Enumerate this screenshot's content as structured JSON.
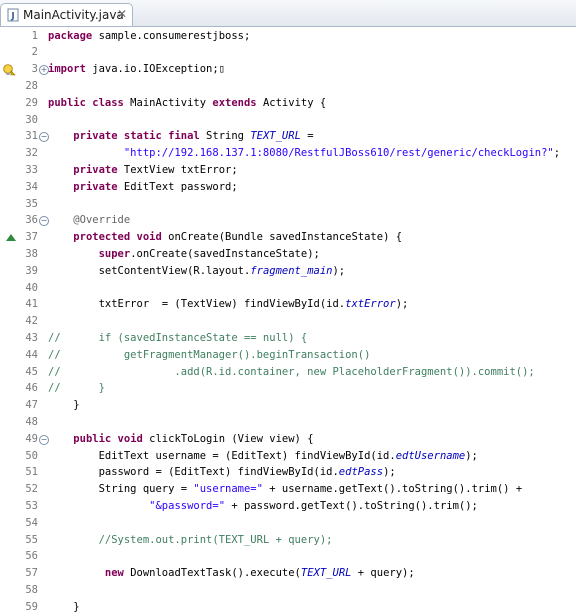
{
  "tab": {
    "title": "MainActivity.java",
    "close_glyph": "✕",
    "icon": "java-file-icon"
  },
  "lines": [
    {
      "no": "1",
      "segs": [
        {
          "t": "package",
          "c": "kw"
        },
        {
          "t": " sample.consumerestjboss;",
          "c": ""
        }
      ]
    },
    {
      "no": "2",
      "segs": []
    },
    {
      "no": "3",
      "fold": "plus",
      "marker": "warning",
      "segs": [
        {
          "t": "import",
          "c": "kw"
        },
        {
          "t": " java.io.IOException;",
          "c": ""
        },
        {
          "t": "▯",
          "c": ""
        }
      ]
    },
    {
      "no": "28",
      "segs": []
    },
    {
      "no": "29",
      "segs": [
        {
          "t": "public class",
          "c": "kw"
        },
        {
          "t": " MainActivity ",
          "c": ""
        },
        {
          "t": "extends",
          "c": "kw"
        },
        {
          "t": " Activity {",
          "c": ""
        }
      ]
    },
    {
      "no": "30",
      "segs": []
    },
    {
      "no": "31",
      "fold": "minus",
      "segs": [
        {
          "t": "    ",
          "c": ""
        },
        {
          "t": "private static final",
          "c": "kw"
        },
        {
          "t": " String ",
          "c": ""
        },
        {
          "t": "TEXT_URL",
          "c": "fld"
        },
        {
          "t": " =",
          "c": ""
        }
      ]
    },
    {
      "no": "32",
      "segs": [
        {
          "t": "            ",
          "c": ""
        },
        {
          "t": "\"http://192.168.137.1:8080/RestfulJBoss610/rest/generic/checkLogin?\"",
          "c": "str"
        },
        {
          "t": ";",
          "c": ""
        }
      ]
    },
    {
      "no": "33",
      "segs": [
        {
          "t": "    ",
          "c": ""
        },
        {
          "t": "private",
          "c": "kw"
        },
        {
          "t": " TextView txtError;",
          "c": ""
        }
      ]
    },
    {
      "no": "34",
      "segs": [
        {
          "t": "    ",
          "c": ""
        },
        {
          "t": "private",
          "c": "kw"
        },
        {
          "t": " EditText password;",
          "c": ""
        }
      ]
    },
    {
      "no": "35",
      "segs": []
    },
    {
      "no": "36",
      "fold": "minus",
      "segs": [
        {
          "t": "    ",
          "c": ""
        },
        {
          "t": "@Override",
          "c": "ann"
        }
      ]
    },
    {
      "no": "37",
      "marker": "override",
      "segs": [
        {
          "t": "    ",
          "c": ""
        },
        {
          "t": "protected void",
          "c": "kw"
        },
        {
          "t": " onCreate(Bundle savedInstanceState) {",
          "c": ""
        }
      ]
    },
    {
      "no": "38",
      "segs": [
        {
          "t": "        ",
          "c": ""
        },
        {
          "t": "super",
          "c": "kw"
        },
        {
          "t": ".onCreate(savedInstanceState);",
          "c": ""
        }
      ]
    },
    {
      "no": "39",
      "segs": [
        {
          "t": "        setContentView(R.layout.",
          "c": ""
        },
        {
          "t": "fragment_main",
          "c": "fld"
        },
        {
          "t": ");",
          "c": ""
        }
      ]
    },
    {
      "no": "40",
      "segs": []
    },
    {
      "no": "41",
      "segs": [
        {
          "t": "        txtError  = (TextView) findViewById(id.",
          "c": ""
        },
        {
          "t": "txtError",
          "c": "fld"
        },
        {
          "t": ");",
          "c": ""
        }
      ]
    },
    {
      "no": "42",
      "segs": []
    },
    {
      "no": "43",
      "segs": [
        {
          "t": "//      if (savedInstanceState == null) {",
          "c": "cmt"
        }
      ]
    },
    {
      "no": "44",
      "segs": [
        {
          "t": "//          getFragmentManager().beginTransaction()",
          "c": "cmt"
        }
      ]
    },
    {
      "no": "45",
      "segs": [
        {
          "t": "//                  .add(R.id.container, new PlaceholderFragment()).commit();",
          "c": "cmt"
        }
      ]
    },
    {
      "no": "46",
      "segs": [
        {
          "t": "//      }",
          "c": "cmt"
        }
      ]
    },
    {
      "no": "47",
      "segs": [
        {
          "t": "    }",
          "c": ""
        }
      ]
    },
    {
      "no": "48",
      "segs": []
    },
    {
      "no": "49",
      "fold": "minus",
      "segs": [
        {
          "t": "    ",
          "c": ""
        },
        {
          "t": "public void",
          "c": "kw"
        },
        {
          "t": " clickToLogin (View view) {",
          "c": ""
        }
      ]
    },
    {
      "no": "50",
      "segs": [
        {
          "t": "        EditText username = (EditText) findViewById(id.",
          "c": ""
        },
        {
          "t": "edtUsername",
          "c": "fld"
        },
        {
          "t": ");",
          "c": ""
        }
      ]
    },
    {
      "no": "51",
      "segs": [
        {
          "t": "        password = (EditText) findViewById(id.",
          "c": ""
        },
        {
          "t": "edtPass",
          "c": "fld"
        },
        {
          "t": ");",
          "c": ""
        }
      ]
    },
    {
      "no": "52",
      "segs": [
        {
          "t": "        String query = ",
          "c": ""
        },
        {
          "t": "\"username=\"",
          "c": "str"
        },
        {
          "t": " + username.getText().toString().trim() +",
          "c": ""
        }
      ]
    },
    {
      "no": "53",
      "segs": [
        {
          "t": "                ",
          "c": ""
        },
        {
          "t": "\"&password=\"",
          "c": "str"
        },
        {
          "t": " + password.getText().toString().trim();",
          "c": ""
        }
      ]
    },
    {
      "no": "54",
      "segs": []
    },
    {
      "no": "55",
      "segs": [
        {
          "t": "        ",
          "c": ""
        },
        {
          "t": "//System.out.print(TEXT_URL + query);",
          "c": "cmt"
        }
      ]
    },
    {
      "no": "56",
      "segs": []
    },
    {
      "no": "57",
      "segs": [
        {
          "t": "         ",
          "c": ""
        },
        {
          "t": "new",
          "c": "kw"
        },
        {
          "t": " DownloadTextTask().execute(",
          "c": ""
        },
        {
          "t": "TEXT_URL",
          "c": "fld"
        },
        {
          "t": " + query);",
          "c": ""
        }
      ]
    },
    {
      "no": "58",
      "segs": []
    },
    {
      "no": "59",
      "segs": [
        {
          "t": "    }",
          "c": ""
        }
      ]
    }
  ]
}
